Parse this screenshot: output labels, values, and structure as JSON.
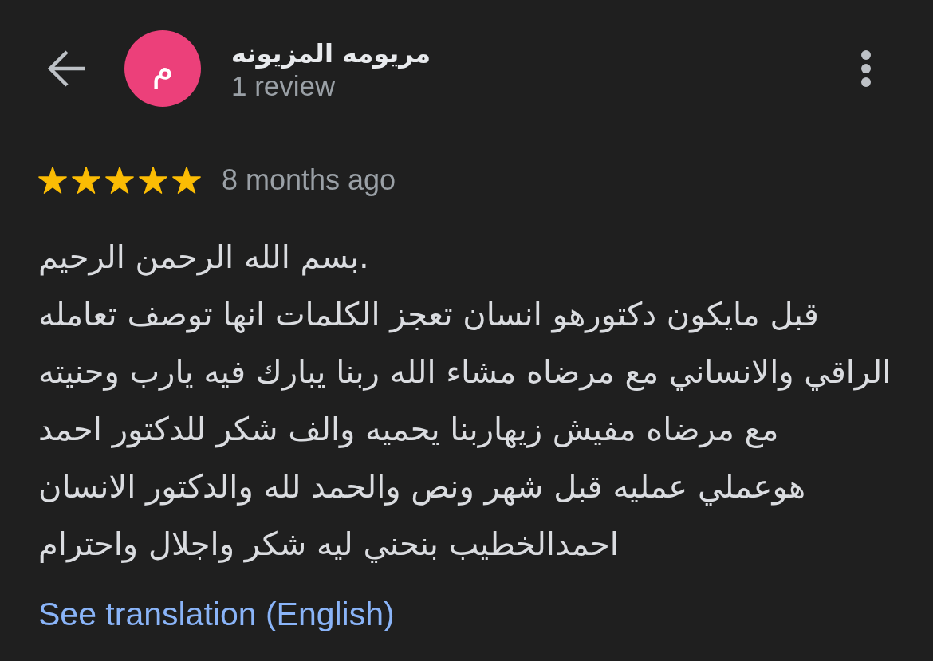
{
  "header": {
    "avatar_initial": "م",
    "reviewer_name": "مريومه المزيونه",
    "review_count": "1 review"
  },
  "review": {
    "stars": 5,
    "time": "8 months ago",
    "text": "بسم الله الرحمن الرحيم.\nقبل مايكون دكتورهو انسان تعجز الكلمات انها توصف تعامله\nالراقي والانساني مع مرضاه مشاء الله ربنا يبارك فيه يارب وحنيته\nمع مرضاه مفيش زيهاربنا يحميه والف شكر للدكتور احمد\nهوعملي عمليه قبل شهر ونص والحمد لله والدكتور الانسان\nاحمدالخطيب بنحني ليه شكر واجلال واحترام",
    "translation_link": "See translation (English)"
  }
}
